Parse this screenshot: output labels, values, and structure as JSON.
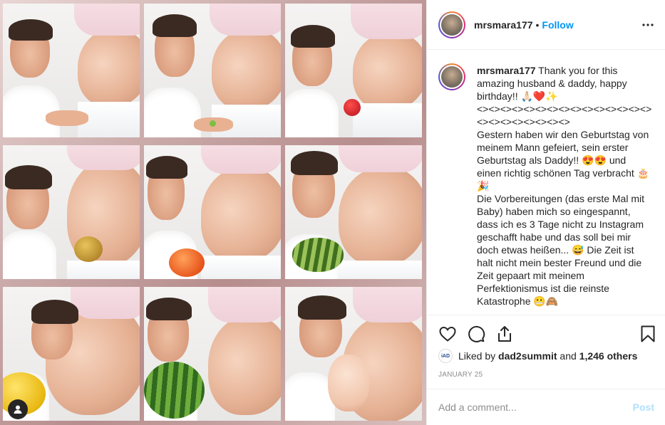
{
  "post": {
    "username": "mrsmara177",
    "follow_label": "Follow",
    "separator": "•",
    "caption_lines": [
      "Thank you for this",
      "amazing husband & daddy, happy",
      "birthday!! 🙏🏻❤️✨",
      "<><><><><><><><><><><><><><><>",
      "<><><><><><><><>",
      "Gestern haben wir den Geburtstag von",
      "meinem Mann gefeiert, sein erster",
      "Geburtstag als Daddy!! 😍😍 und",
      "einen richtig schönen Tag verbracht 🎂",
      "🎉",
      "Die Vorbereitungen (das erste Mal mit",
      "Baby) haben mich so eingespannt,",
      "dass ich es 3 Tage nicht zu Instagram",
      "geschafft habe und das soll bei mir",
      "doch etwas heißen... 😅 Die Zeit ist",
      "halt nicht mein bester Freund und die",
      "Zeit gepaart mit meinem",
      "Perfektionismus ist die reinste",
      "Katastrophe 😬🙈"
    ],
    "liked_by_prefix": "Liked by",
    "liked_by_user": "dad2summit",
    "liked_and": "and",
    "liked_others": "1,246 others",
    "liker_avatar_text": "iAD",
    "date": "JANUARY 25",
    "comment_placeholder": "Add a comment...",
    "post_button": "Post"
  },
  "icons": {
    "more": "more-horizontal-icon",
    "like": "heart-icon",
    "comment": "comment-icon",
    "share": "share-icon",
    "save": "bookmark-icon",
    "tagged": "user-tag-icon"
  },
  "colors": {
    "accent": "#0095f6",
    "post_disabled": "#b2dffc",
    "muted": "#8e8e8e",
    "text": "#262626",
    "border": "#efefef"
  }
}
